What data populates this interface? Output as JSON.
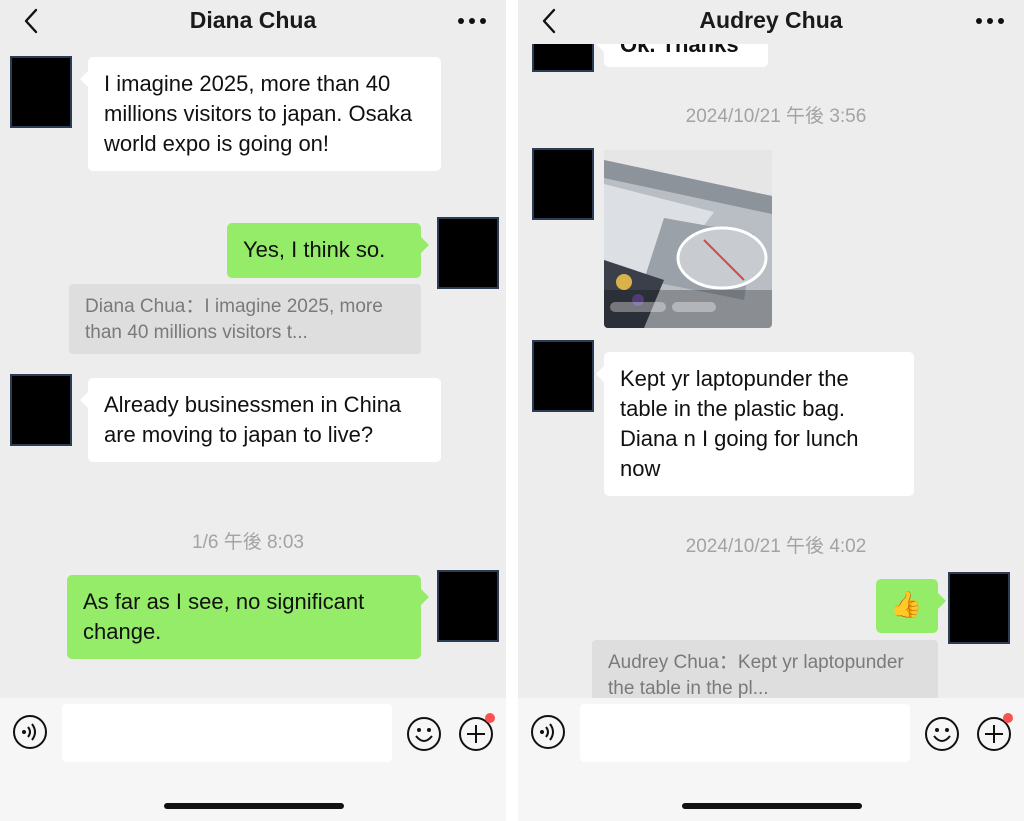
{
  "left": {
    "header": {
      "title": "Diana Chua"
    },
    "messages": {
      "m1": "I imagine 2025, more than 40 millions visitors to japan. Osaka world expo is going on!",
      "m2": "Yes, I think so.",
      "quote": "Diana Chua：I imagine 2025, more than 40 millions visitors t...",
      "m3": "Already businessmen in China are moving to japan to live?",
      "time1": "1/6 午後 8:03",
      "m4": "As far as I see, no significant change."
    }
  },
  "right": {
    "header": {
      "title": "Audrey  Chua"
    },
    "messages": {
      "cut": "Ok. Thanks",
      "time1": "2024/10/21 午後 3:56",
      "m1": "Kept yr laptopunder the table in the plastic bag. Diana n I going for lunch now",
      "time2": "2024/10/21 午後 4:02",
      "sticker": "👍",
      "quote": "Audrey  Chua：Kept yr laptopunder the table in the pl..."
    }
  },
  "icons": {
    "back": "chevron-left-icon",
    "more": "ellipsis-icon",
    "voice": "voice-icon",
    "emoji": "emoji-icon",
    "plus": "plus-icon"
  },
  "colors": {
    "background": "#ededed",
    "incoming_bubble": "#ffffff",
    "outgoing_bubble": "#95ec69",
    "quote_bg": "#dedede",
    "badge": "#fa5151"
  }
}
